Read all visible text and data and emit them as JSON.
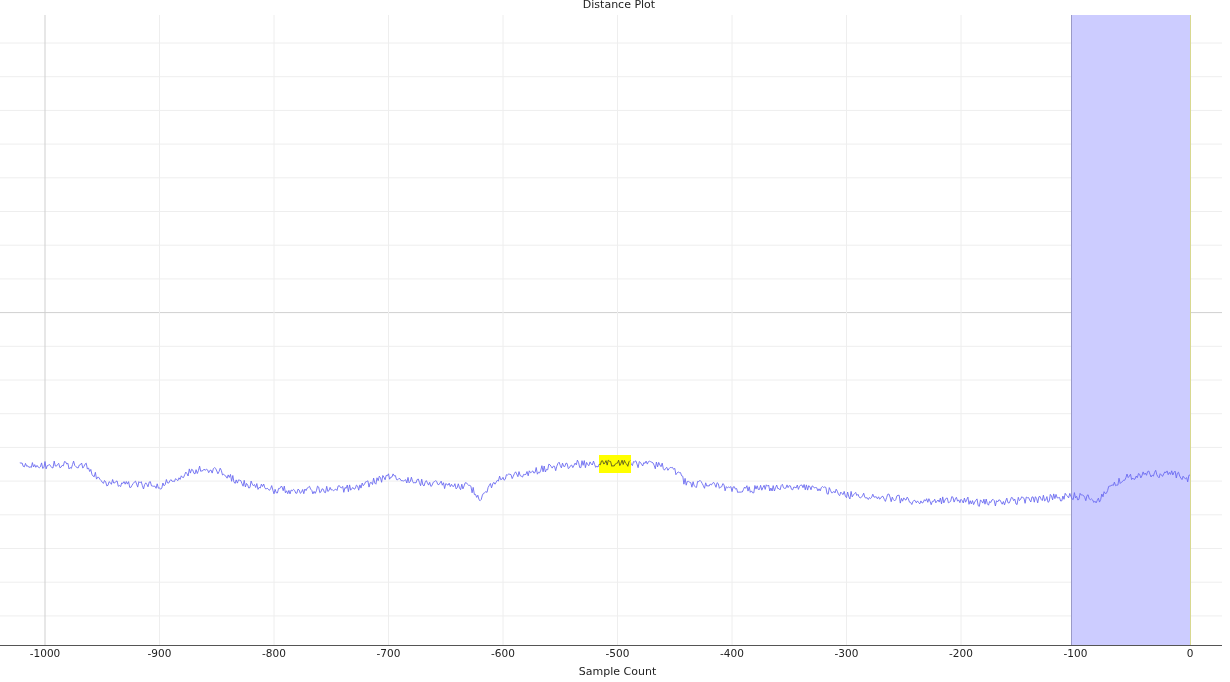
{
  "title": "Distance Plot",
  "x_axis": {
    "label": "Sample Count",
    "ticks": [
      "-1000",
      "-900",
      "-800",
      "-700",
      "-600",
      "-500",
      "-400",
      "-300",
      "-200",
      "-100",
      "0"
    ]
  }
}
